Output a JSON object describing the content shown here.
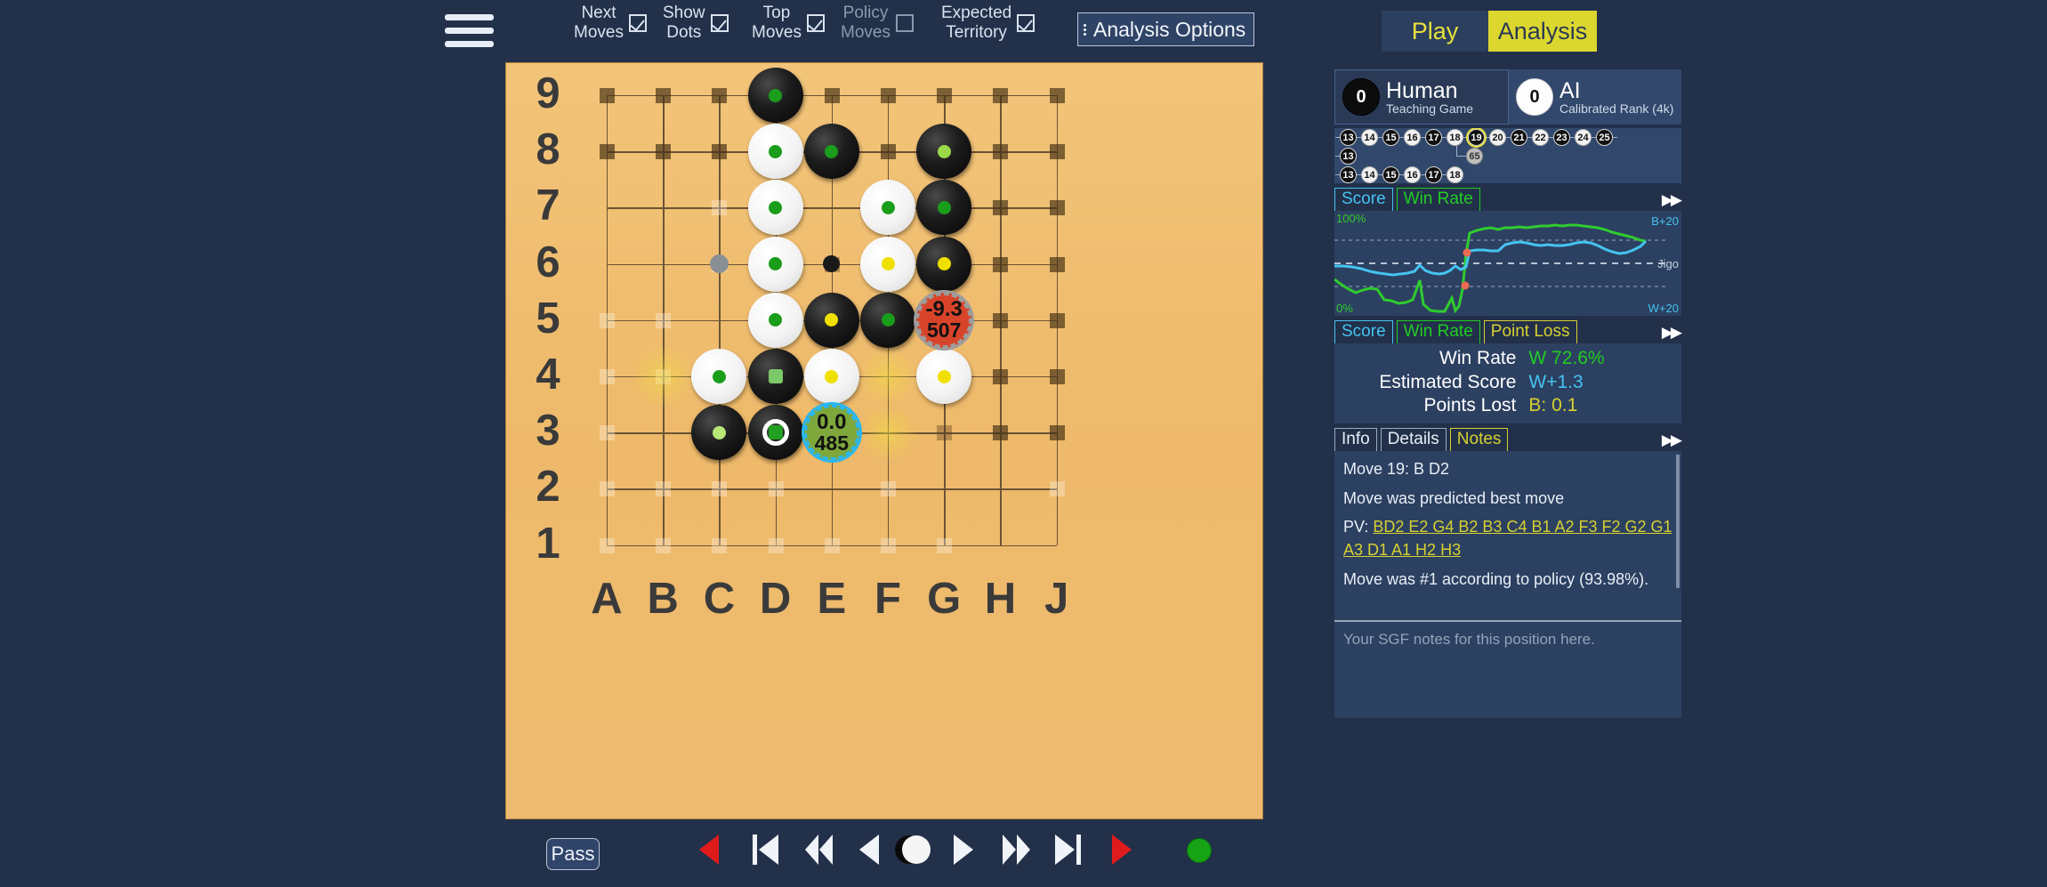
{
  "topbar": {
    "menu_icon": "hamburger-icon",
    "toggles": [
      {
        "label": "Next\nMoves",
        "checked": true,
        "dim": false
      },
      {
        "label": "Show\nDots",
        "checked": true,
        "dim": false
      },
      {
        "label": "Top\nMoves",
        "checked": true,
        "dim": false
      },
      {
        "label": "Policy\nMoves",
        "checked": false,
        "dim": true
      },
      {
        "label": "Expected\nTerritory",
        "checked": true,
        "dim": false
      }
    ],
    "analysis_options_label": "Analysis Options"
  },
  "mode_tabs": {
    "play": "Play",
    "analysis": "Analysis",
    "active": "Analysis"
  },
  "players": {
    "black": {
      "captures": "0",
      "name": "Human",
      "subtitle": "Teaching Game",
      "color": "black"
    },
    "white": {
      "captures": "0",
      "name": "AI",
      "subtitle": "Calibrated Rank (4k)",
      "color": "white"
    }
  },
  "move_tree": {
    "current_node": "19",
    "rows": [
      {
        "nodes": [
          {
            "n": "13",
            "c": "b"
          },
          {
            "n": "14",
            "c": "w"
          },
          {
            "n": "15",
            "c": "b"
          },
          {
            "n": "16",
            "c": "w"
          },
          {
            "n": "17",
            "c": "b"
          },
          {
            "n": "18",
            "c": "w"
          },
          {
            "n": "19",
            "c": "b",
            "current": true
          },
          {
            "n": "20",
            "c": "w"
          },
          {
            "n": "21",
            "c": "b"
          },
          {
            "n": "22",
            "c": "w"
          },
          {
            "n": "23",
            "c": "b"
          },
          {
            "n": "24",
            "c": "w"
          },
          {
            "n": "25",
            "c": "b"
          }
        ]
      },
      {
        "nodes": [
          {
            "n": "13",
            "c": "b"
          }
        ]
      },
      {
        "nodes": [
          {
            "n": "13",
            "c": "b"
          },
          {
            "n": "14",
            "c": "w"
          },
          {
            "n": "15",
            "c": "b"
          },
          {
            "n": "16",
            "c": "w"
          },
          {
            "n": "17",
            "c": "b"
          },
          {
            "n": "18",
            "c": "w"
          }
        ]
      }
    ],
    "branch_node": {
      "n": "65",
      "c": "g"
    }
  },
  "graph": {
    "tabs": [
      {
        "label": "Score",
        "style": "score"
      },
      {
        "label": "Win Rate",
        "style": "winrate"
      }
    ],
    "top_left_label": "100%",
    "bottom_left_label": "0%",
    "top_right_label": "B+20",
    "mid_right_label": "Jigo",
    "bottom_right_label": "W+20",
    "fastforward_icon": "fast-forward-icon"
  },
  "stats": {
    "tabs": [
      {
        "label": "Score",
        "style": "score"
      },
      {
        "label": "Win Rate",
        "style": "winrate"
      },
      {
        "label": "Point Loss",
        "style": "pointloss"
      }
    ],
    "rows": [
      {
        "label": "Win Rate",
        "value": "W 72.6%",
        "color": "#22cc22"
      },
      {
        "label": "Estimated Score",
        "value": "W+1.3",
        "color": "#45c3f0"
      },
      {
        "label": "Points Lost",
        "value": "B: 0.1",
        "color": "#d7d130"
      }
    ]
  },
  "info": {
    "tabs": [
      {
        "label": "Info",
        "style": "plain"
      },
      {
        "label": "Details",
        "style": "plain"
      },
      {
        "label": "Notes",
        "style": "notes"
      }
    ],
    "move_line": "Move 19: B D2",
    "predicted_line": "Move was predicted best move",
    "pv_prefix": "PV: ",
    "pv_moves": "BD2 E2 G4 B2 B3 C4 B1 A2 F3 F2 G2 G1 A3 D1 A1 H2 H3",
    "policy_line": "Move was #1 according to policy  (93.98%).",
    "notes_placeholder": "Your SGF notes for this position here."
  },
  "board": {
    "size": 9,
    "col_labels": [
      "A",
      "B",
      "C",
      "D",
      "E",
      "F",
      "G",
      "H",
      "J"
    ],
    "row_labels": [
      "9",
      "8",
      "7",
      "6",
      "5",
      "4",
      "3",
      "2",
      "1"
    ],
    "stones": [
      {
        "col": 3,
        "row": 8,
        "color": "black",
        "dot": "#1a9d1a",
        "shape": "circle"
      },
      {
        "col": 3,
        "row": 7,
        "color": "white",
        "dot": "#1a9d1a",
        "shape": "circle"
      },
      {
        "col": 4,
        "row": 7,
        "color": "black",
        "dot": "#1a9d1a",
        "shape": "circle"
      },
      {
        "col": 6,
        "row": 7,
        "color": "black",
        "dot": "#9ada4a",
        "shape": "circle"
      },
      {
        "col": 3,
        "row": 6,
        "color": "white",
        "dot": "#1a9d1a",
        "shape": "circle"
      },
      {
        "col": 5,
        "row": 6,
        "color": "white",
        "dot": "#1a9d1a",
        "shape": "circle"
      },
      {
        "col": 6,
        "row": 6,
        "color": "black",
        "dot": "#1a9d1a",
        "shape": "circle"
      },
      {
        "col": 3,
        "row": 5,
        "color": "white",
        "dot": "#1a9d1a",
        "shape": "circle"
      },
      {
        "col": 5,
        "row": 5,
        "color": "white",
        "dot": "#f0e000",
        "shape": "circle"
      },
      {
        "col": 6,
        "row": 5,
        "color": "black",
        "dot": "#f0e000",
        "shape": "circle"
      },
      {
        "col": 3,
        "row": 4,
        "color": "white",
        "dot": "#1a9d1a",
        "shape": "circle"
      },
      {
        "col": 4,
        "row": 4,
        "color": "black",
        "dot": "#f0e000",
        "shape": "circle"
      },
      {
        "col": 5,
        "row": 4,
        "color": "black",
        "dot": "#1a9d1a",
        "shape": "circle"
      },
      {
        "col": 2,
        "row": 3,
        "color": "white",
        "dot": "#1a9d1a",
        "shape": "circle"
      },
      {
        "col": 3,
        "row": 3,
        "color": "black",
        "dot": "#7dc96a",
        "shape": "square"
      },
      {
        "col": 4,
        "row": 3,
        "color": "white",
        "dot": "#f0e000",
        "shape": "circle"
      },
      {
        "col": 6,
        "row": 3,
        "color": "white",
        "dot": "#f0e000",
        "shape": "circle"
      },
      {
        "col": 2,
        "row": 2,
        "color": "black",
        "dot": "#b8e878",
        "shape": "circle"
      },
      {
        "col": 3,
        "row": 2,
        "color": "black",
        "dot": "#22a022",
        "shape": "square",
        "last": true
      }
    ],
    "candidates": [
      {
        "col": 6,
        "row": 4,
        "v1": "-9.3",
        "v2": "507",
        "fill": "#d8442a",
        "ring": "#9c9c9c"
      },
      {
        "col": 4,
        "row": 2,
        "v1": "0.0",
        "v2": "485",
        "fill": "#7ea83c",
        "ring": "#29b6f0"
      }
    ],
    "ghost_stones": [
      {
        "col": 4,
        "row": 7,
        "color": "#1a1a1a",
        "size": 19
      },
      {
        "col": 4,
        "row": 5,
        "color": "#1a1a1a",
        "size": 19
      },
      {
        "col": 2,
        "row": 5,
        "color": "#8a8f96",
        "size": 21
      }
    ],
    "policy_blobs": [
      {
        "col": 1,
        "row": 3,
        "color": "rgba(240,226,60,0.45)",
        "size": 72
      },
      {
        "col": 5,
        "row": 3,
        "color": "rgba(240,226,60,0.45)",
        "size": 66
      },
      {
        "col": 5,
        "row": 2,
        "color": "rgba(240,226,60,0.45)",
        "size": 66
      }
    ],
    "territory": {
      "black_color": "rgba(70,48,20,0.80)",
      "white_color": "rgba(255,248,236,0.80)",
      "rows": [
        "BBBBBBBBB",
        "BBBBBBBBB",
        "..wb.w.BB",
        "..wwb..BB",
        "ww.ww..BB",
        "wwww...BB",
        "w.w...bBB",
        "wwww.w..w",
        "wwwwwww.."
      ]
    }
  },
  "bottom_bar": {
    "pass_label": "Pass",
    "controls": [
      {
        "name": "undo-branch-button",
        "icon": "red-left-arrow-icon"
      },
      {
        "name": "first-move-button",
        "icon": "skip-to-start-icon"
      },
      {
        "name": "back-ten-button",
        "icon": "rewind-icon"
      },
      {
        "name": "previous-move-button",
        "icon": "step-back-icon"
      },
      {
        "name": "turn-indicator",
        "icon": "black-white-stone-icon"
      },
      {
        "name": "next-move-button",
        "icon": "step-forward-icon"
      },
      {
        "name": "forward-ten-button",
        "icon": "fast-forward-icon"
      },
      {
        "name": "last-move-button",
        "icon": "skip-to-end-icon"
      },
      {
        "name": "redo-branch-button",
        "icon": "red-right-arrow-icon"
      }
    ],
    "status_dot_color": "#16a416"
  }
}
